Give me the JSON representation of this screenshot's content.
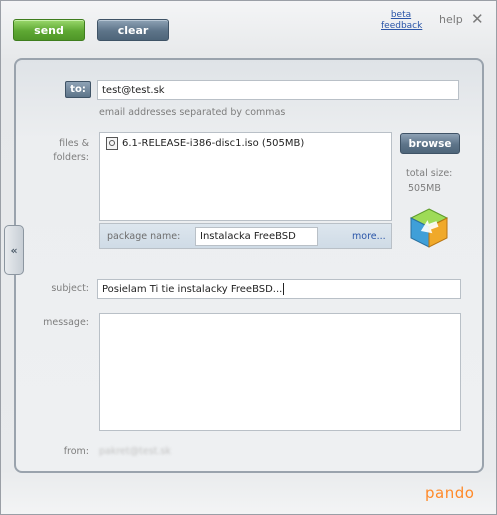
{
  "toolbar": {
    "send_label": "send",
    "clear_label": "clear",
    "beta_feedback_label": "beta feedback",
    "help_label": "help",
    "close_glyph": "✕"
  },
  "form": {
    "to_button_label": "to:",
    "to_value": "test@test.sk",
    "email_hint": "email addresses separated by commas",
    "files_label": "files & folders:",
    "files": [
      {
        "name": "6.1-RELEASE-i386-disc1.iso (505MB)",
        "icon": "iso-file-icon"
      }
    ],
    "package_name_label": "package name:",
    "package_name_value": "Instalacka FreeBSD",
    "more_label": "more...",
    "browse_label": "browse",
    "total_size_label": "total size:",
    "total_size_value": "505MB",
    "subject_label": "subject:",
    "subject_value": "Posielam Ti tie instalacky FreeBSD...",
    "message_label": "message:",
    "message_value": "",
    "from_label": "from:",
    "from_value": "pakret@test.sk"
  },
  "branding": {
    "logo_text": "pando"
  },
  "colors": {
    "send_green": "#5ea833",
    "steel_blue": "#5d7489",
    "link_blue": "#2a55a8",
    "pando_orange": "#ff8a2a"
  }
}
